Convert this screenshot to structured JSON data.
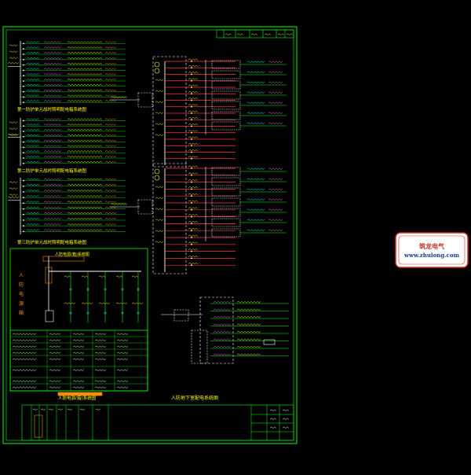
{
  "drawing": {
    "colors": {
      "background": "#000000",
      "frame": "#00ff00",
      "feeder": "#ff3b3b",
      "text": "#ffff00",
      "busbar": "#ffffff",
      "breaker": "#00ffff",
      "label": "#ff66ff",
      "accent": "#ff8c00"
    },
    "main_title": "人防地下室配电系统图",
    "inset_title": "人防电源(箱)系统图",
    "inset_side_label": "人防电源箱",
    "section_labels": [
      "第一防护单元战时照明配电箱系统图",
      "第二防护单元战时照明配电箱系统图",
      "第三防护单元战时照明配电箱系统图"
    ],
    "spare_label": "备用",
    "watermark_brand": "筑龙电气",
    "watermark_url": "www.zhulong.com"
  }
}
